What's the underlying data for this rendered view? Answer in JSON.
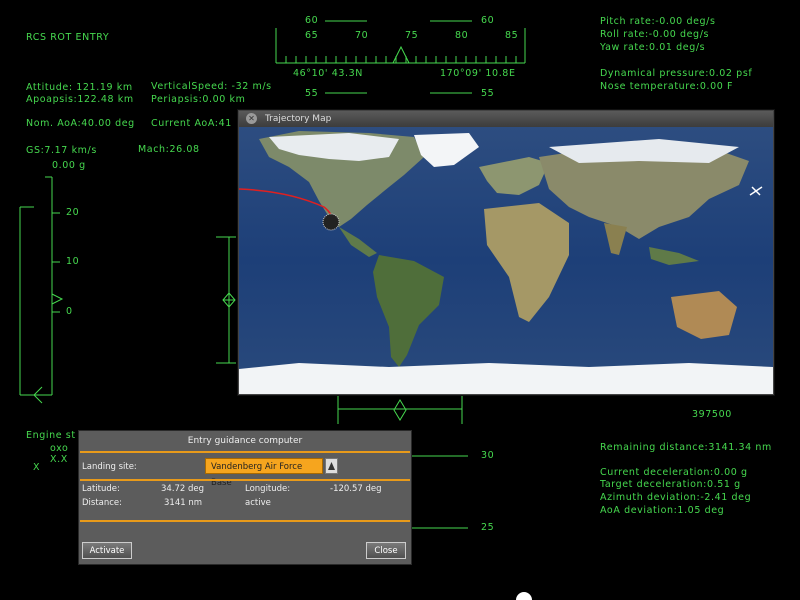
{
  "hud": {
    "mode": "RCS ROT ENTRY",
    "attitude": "Attitude: 121.19 km",
    "apoapsis": "Apoapsis:122.48 km",
    "vertical_speed": "VerticalSpeed: -32 m/s",
    "periapsis": "Periapsis:0.00 km",
    "nom_aoa": "Nom. AoA:40.00 deg",
    "current_aoa": "Current AoA:41",
    "gs": "GS:7.17 km/s",
    "mach": "Mach:26.08",
    "g_load": "0.00 g",
    "pitch_rate": "Pitch rate:-0.00 deg/s",
    "roll_rate": "Roll rate:-0.00 deg/s",
    "yaw_rate": "Yaw rate:0.01 deg/s",
    "dyn_pressure": "Dynamical pressure:0.02 psf",
    "nose_temp": "Nose temperature:0.00 F",
    "engine": "Engine st",
    "engine_sub1": "oxo",
    "engine_sub2": "X.X",
    "engine_sub3": "X",
    "remaining": "Remaining distance:3141.34 nm",
    "cur_decel": "Current deceleration:0.00 g",
    "tgt_decel": "Target deceleration:0.51 g",
    "azimuth_dev": "Azimuth deviation:-2.41 deg",
    "aoa_dev": "AoA deviation:1.05 deg",
    "altitude_readout": "397500"
  },
  "heading_tape": {
    "top_left": "60",
    "top_right": "60",
    "ticks": [
      "65",
      "70",
      "75",
      "80",
      "85"
    ],
    "lat": "46°10' 43.3N",
    "lon": "170°09' 10.8E",
    "bottom_left": "55",
    "bottom_right": "55"
  },
  "gload_tape": {
    "labels": [
      "20",
      "10",
      "0"
    ]
  },
  "pitch_ladder": {
    "labels": [
      "30",
      "25"
    ]
  },
  "map_window": {
    "title": "Trajectory Map"
  },
  "guidance": {
    "title": "Entry guidance computer",
    "landing_site_label": "Landing site:",
    "landing_site_value": "Vandenberg Air Force Base",
    "latitude_label": "Latitude:",
    "latitude_value": "34.72 deg",
    "longitude_label": "Longitude:",
    "longitude_value": "-120.57 deg",
    "distance_label": "Distance:",
    "distance_value": "3141 nm",
    "status": "active",
    "activate_button": "Activate",
    "close_button": "Close"
  },
  "colors": {
    "hud_green": "#46d94f",
    "accent_orange": "#f6a51e",
    "trajectory": "#e02020"
  }
}
